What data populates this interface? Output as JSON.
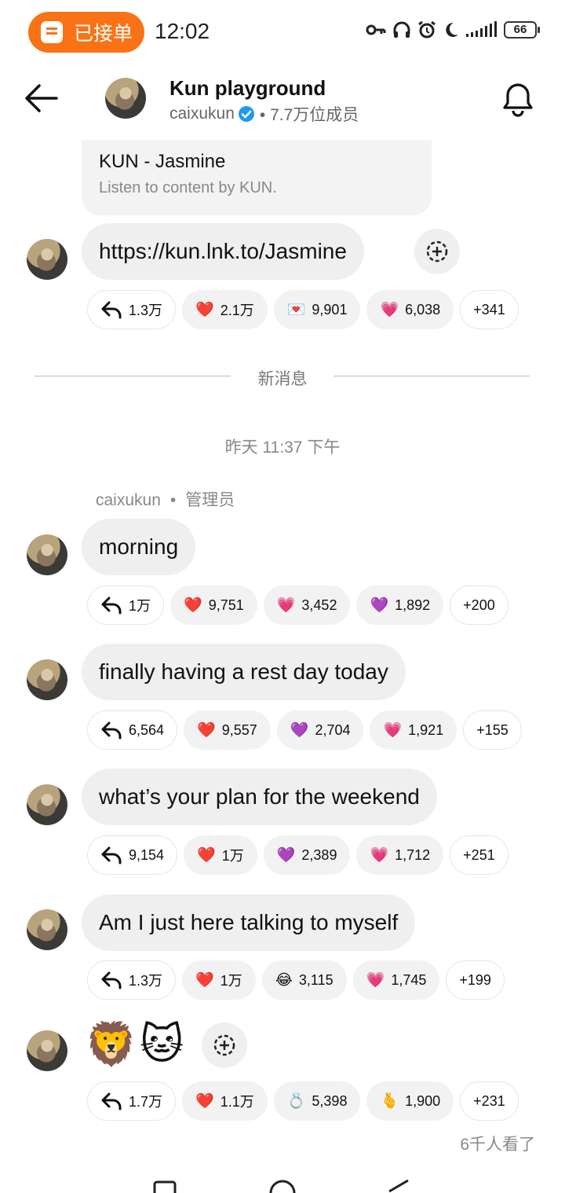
{
  "status_bar": {
    "pill_label": "已接单",
    "time": "12:02",
    "battery": "66"
  },
  "header": {
    "title": "Kun playground",
    "username": "caixukun",
    "members": "• 7.7万位成员"
  },
  "link_card": {
    "title": "KUN - Jasmine",
    "desc": "Listen to content by KUN."
  },
  "messages": [
    {
      "text": "https://kun.lnk.to/Jasmine",
      "reply_count": "1.3万",
      "reactions": [
        {
          "emoji": "❤️",
          "count": "2.1万"
        },
        {
          "emoji": "💌",
          "count": "9,901"
        },
        {
          "emoji": "💗",
          "count": "6,038"
        }
      ],
      "more": "+341"
    },
    {
      "text": "morning",
      "reply_count": "1万",
      "reactions": [
        {
          "emoji": "❤️",
          "count": "9,751"
        },
        {
          "emoji": "💗",
          "count": "3,452"
        },
        {
          "emoji": "💜",
          "count": "1,892"
        }
      ],
      "more": "+200"
    },
    {
      "text": "finally having a rest day today",
      "reply_count": "6,564",
      "reactions": [
        {
          "emoji": "❤️",
          "count": "9,557"
        },
        {
          "emoji": "💜",
          "count": "2,704"
        },
        {
          "emoji": "💗",
          "count": "1,921"
        }
      ],
      "more": "+155"
    },
    {
      "text": "what’s your plan for the weekend",
      "reply_count": "9,154",
      "reactions": [
        {
          "emoji": "❤️",
          "count": "1万"
        },
        {
          "emoji": "💜",
          "count": "2,389"
        },
        {
          "emoji": "💗",
          "count": "1,712"
        }
      ],
      "more": "+251"
    },
    {
      "text": "Am I just here talking to myself",
      "reply_count": "1.3万",
      "reactions": [
        {
          "emoji": "❤️",
          "count": "1万"
        },
        {
          "emoji": "😂",
          "count": "3,115"
        },
        {
          "emoji": "💗",
          "count": "1,745"
        }
      ],
      "more": "+199"
    },
    {
      "text": "🦁 🐱",
      "reply_count": "1.7万",
      "reactions": [
        {
          "emoji": "❤️",
          "count": "1.1万"
        },
        {
          "emoji": "💍",
          "count": "5,398"
        },
        {
          "emoji": "🫰",
          "count": "1,900"
        }
      ],
      "more": "+231"
    }
  ],
  "divider_label": "新消息",
  "date_label": "昨天 11:37 下午",
  "sender": {
    "name": "caixukun",
    "dot": "•",
    "role": "管理员"
  },
  "emojis": [
    "🦁",
    "🐱"
  ],
  "views": "6千人看了",
  "colors": {
    "accent_orange": "#f97316",
    "verified_blue": "#1d9bf0",
    "bubble_gray": "#efefef"
  }
}
